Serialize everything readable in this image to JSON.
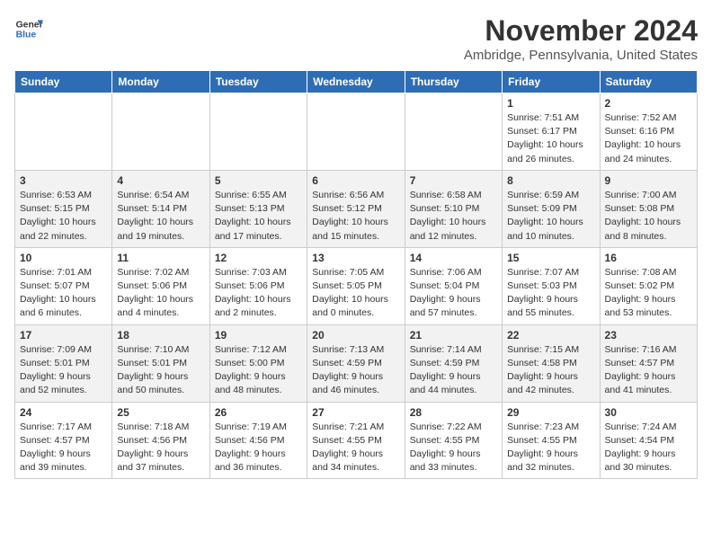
{
  "logo": {
    "line1": "General",
    "line2": "Blue"
  },
  "title": "November 2024",
  "location": "Ambridge, Pennsylvania, United States",
  "weekdays": [
    "Sunday",
    "Monday",
    "Tuesday",
    "Wednesday",
    "Thursday",
    "Friday",
    "Saturday"
  ],
  "weeks": [
    [
      {
        "day": "",
        "info": ""
      },
      {
        "day": "",
        "info": ""
      },
      {
        "day": "",
        "info": ""
      },
      {
        "day": "",
        "info": ""
      },
      {
        "day": "",
        "info": ""
      },
      {
        "day": "1",
        "info": "Sunrise: 7:51 AM\nSunset: 6:17 PM\nDaylight: 10 hours\nand 26 minutes."
      },
      {
        "day": "2",
        "info": "Sunrise: 7:52 AM\nSunset: 6:16 PM\nDaylight: 10 hours\nand 24 minutes."
      }
    ],
    [
      {
        "day": "3",
        "info": "Sunrise: 6:53 AM\nSunset: 5:15 PM\nDaylight: 10 hours\nand 22 minutes."
      },
      {
        "day": "4",
        "info": "Sunrise: 6:54 AM\nSunset: 5:14 PM\nDaylight: 10 hours\nand 19 minutes."
      },
      {
        "day": "5",
        "info": "Sunrise: 6:55 AM\nSunset: 5:13 PM\nDaylight: 10 hours\nand 17 minutes."
      },
      {
        "day": "6",
        "info": "Sunrise: 6:56 AM\nSunset: 5:12 PM\nDaylight: 10 hours\nand 15 minutes."
      },
      {
        "day": "7",
        "info": "Sunrise: 6:58 AM\nSunset: 5:10 PM\nDaylight: 10 hours\nand 12 minutes."
      },
      {
        "day": "8",
        "info": "Sunrise: 6:59 AM\nSunset: 5:09 PM\nDaylight: 10 hours\nand 10 minutes."
      },
      {
        "day": "9",
        "info": "Sunrise: 7:00 AM\nSunset: 5:08 PM\nDaylight: 10 hours\nand 8 minutes."
      }
    ],
    [
      {
        "day": "10",
        "info": "Sunrise: 7:01 AM\nSunset: 5:07 PM\nDaylight: 10 hours\nand 6 minutes."
      },
      {
        "day": "11",
        "info": "Sunrise: 7:02 AM\nSunset: 5:06 PM\nDaylight: 10 hours\nand 4 minutes."
      },
      {
        "day": "12",
        "info": "Sunrise: 7:03 AM\nSunset: 5:06 PM\nDaylight: 10 hours\nand 2 minutes."
      },
      {
        "day": "13",
        "info": "Sunrise: 7:05 AM\nSunset: 5:05 PM\nDaylight: 10 hours\nand 0 minutes."
      },
      {
        "day": "14",
        "info": "Sunrise: 7:06 AM\nSunset: 5:04 PM\nDaylight: 9 hours\nand 57 minutes."
      },
      {
        "day": "15",
        "info": "Sunrise: 7:07 AM\nSunset: 5:03 PM\nDaylight: 9 hours\nand 55 minutes."
      },
      {
        "day": "16",
        "info": "Sunrise: 7:08 AM\nSunset: 5:02 PM\nDaylight: 9 hours\nand 53 minutes."
      }
    ],
    [
      {
        "day": "17",
        "info": "Sunrise: 7:09 AM\nSunset: 5:01 PM\nDaylight: 9 hours\nand 52 minutes."
      },
      {
        "day": "18",
        "info": "Sunrise: 7:10 AM\nSunset: 5:01 PM\nDaylight: 9 hours\nand 50 minutes."
      },
      {
        "day": "19",
        "info": "Sunrise: 7:12 AM\nSunset: 5:00 PM\nDaylight: 9 hours\nand 48 minutes."
      },
      {
        "day": "20",
        "info": "Sunrise: 7:13 AM\nSunset: 4:59 PM\nDaylight: 9 hours\nand 46 minutes."
      },
      {
        "day": "21",
        "info": "Sunrise: 7:14 AM\nSunset: 4:59 PM\nDaylight: 9 hours\nand 44 minutes."
      },
      {
        "day": "22",
        "info": "Sunrise: 7:15 AM\nSunset: 4:58 PM\nDaylight: 9 hours\nand 42 minutes."
      },
      {
        "day": "23",
        "info": "Sunrise: 7:16 AM\nSunset: 4:57 PM\nDaylight: 9 hours\nand 41 minutes."
      }
    ],
    [
      {
        "day": "24",
        "info": "Sunrise: 7:17 AM\nSunset: 4:57 PM\nDaylight: 9 hours\nand 39 minutes."
      },
      {
        "day": "25",
        "info": "Sunrise: 7:18 AM\nSunset: 4:56 PM\nDaylight: 9 hours\nand 37 minutes."
      },
      {
        "day": "26",
        "info": "Sunrise: 7:19 AM\nSunset: 4:56 PM\nDaylight: 9 hours\nand 36 minutes."
      },
      {
        "day": "27",
        "info": "Sunrise: 7:21 AM\nSunset: 4:55 PM\nDaylight: 9 hours\nand 34 minutes."
      },
      {
        "day": "28",
        "info": "Sunrise: 7:22 AM\nSunset: 4:55 PM\nDaylight: 9 hours\nand 33 minutes."
      },
      {
        "day": "29",
        "info": "Sunrise: 7:23 AM\nSunset: 4:55 PM\nDaylight: 9 hours\nand 32 minutes."
      },
      {
        "day": "30",
        "info": "Sunrise: 7:24 AM\nSunset: 4:54 PM\nDaylight: 9 hours\nand 30 minutes."
      }
    ]
  ]
}
